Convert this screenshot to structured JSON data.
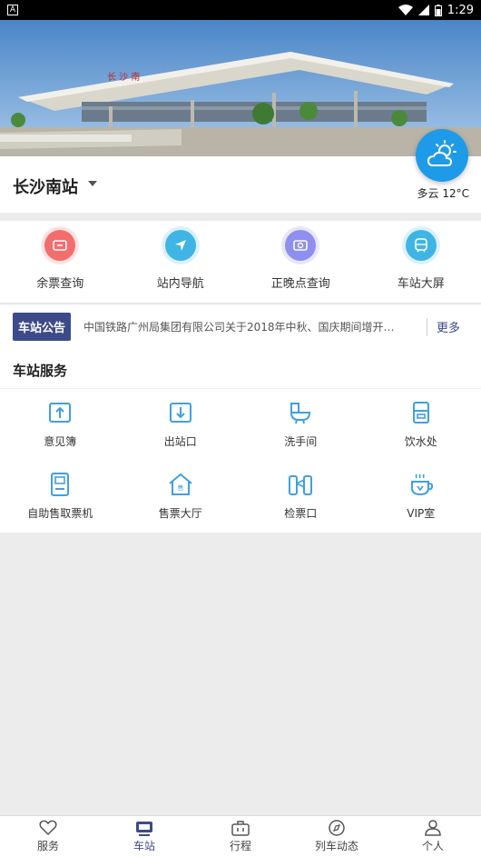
{
  "status_bar": {
    "time": "1:29",
    "left_icon": "A"
  },
  "hero": {
    "sign_text": "长 沙 南"
  },
  "station": {
    "name": "长沙南站"
  },
  "weather": {
    "text": "多云  12°C"
  },
  "quick_actions": [
    {
      "label": "余票查询",
      "color": "#f36d6d"
    },
    {
      "label": "站内导航",
      "color": "#3fb5e6"
    },
    {
      "label": "正晚点查询",
      "color": "#8f8ff0"
    },
    {
      "label": "车站大屏",
      "color": "#3fb5e6"
    }
  ],
  "notice": {
    "tag": "车站公告",
    "text": "中国铁路广州局集团有限公司关于2018年中秋、国庆期间增开…",
    "more": "更多"
  },
  "services": {
    "title": "车站服务",
    "items": [
      {
        "label": "意见簿"
      },
      {
        "label": "出站口"
      },
      {
        "label": "洗手间"
      },
      {
        "label": "饮水处"
      },
      {
        "label": "自助售取票机"
      },
      {
        "label": "售票大厅"
      },
      {
        "label": "检票口"
      },
      {
        "label": "VIP室"
      }
    ]
  },
  "tabs": [
    {
      "label": "服务"
    },
    {
      "label": "车站"
    },
    {
      "label": "行程"
    },
    {
      "label": "列车动态"
    },
    {
      "label": "个人"
    }
  ],
  "accent_color": "#3d4a8a",
  "weather_badge_color": "#1e9be8"
}
